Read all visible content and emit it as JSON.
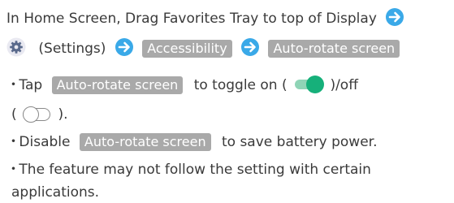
{
  "step": {
    "intro": "In Home Screen, Drag Favorites Tray to top of Display",
    "settings_label": "(Settings)",
    "accessibility_key": "Accessibility",
    "autorotate_key": "Auto-rotate screen"
  },
  "notes": [
    {
      "bullet": "・",
      "prefix": "Tap",
      "key": "Auto-rotate screen",
      "middle": "to toggle on (",
      "suffix": ")/off",
      "line2_open": "(",
      "line2_close": ")."
    },
    {
      "bullet": "・",
      "prefix": "Disable",
      "key": "Auto-rotate screen",
      "suffix": "to save battery power."
    },
    {
      "bullet": "・",
      "text": "The feature may not follow the setting with certain",
      "text2": "applications."
    }
  ],
  "icons": {
    "arrow": "arrow-right-circle-icon",
    "settings": "gear-icon",
    "toggle_on": "toggle-on-icon",
    "toggle_off": "toggle-off-icon"
  },
  "colors": {
    "text": "#3a3a3a",
    "arrow": "#3aa9e8",
    "key_bg": "#a9a9a9",
    "toggle_on_knob": "#16b07a",
    "toggle_on_track": "#8fd4b6"
  }
}
